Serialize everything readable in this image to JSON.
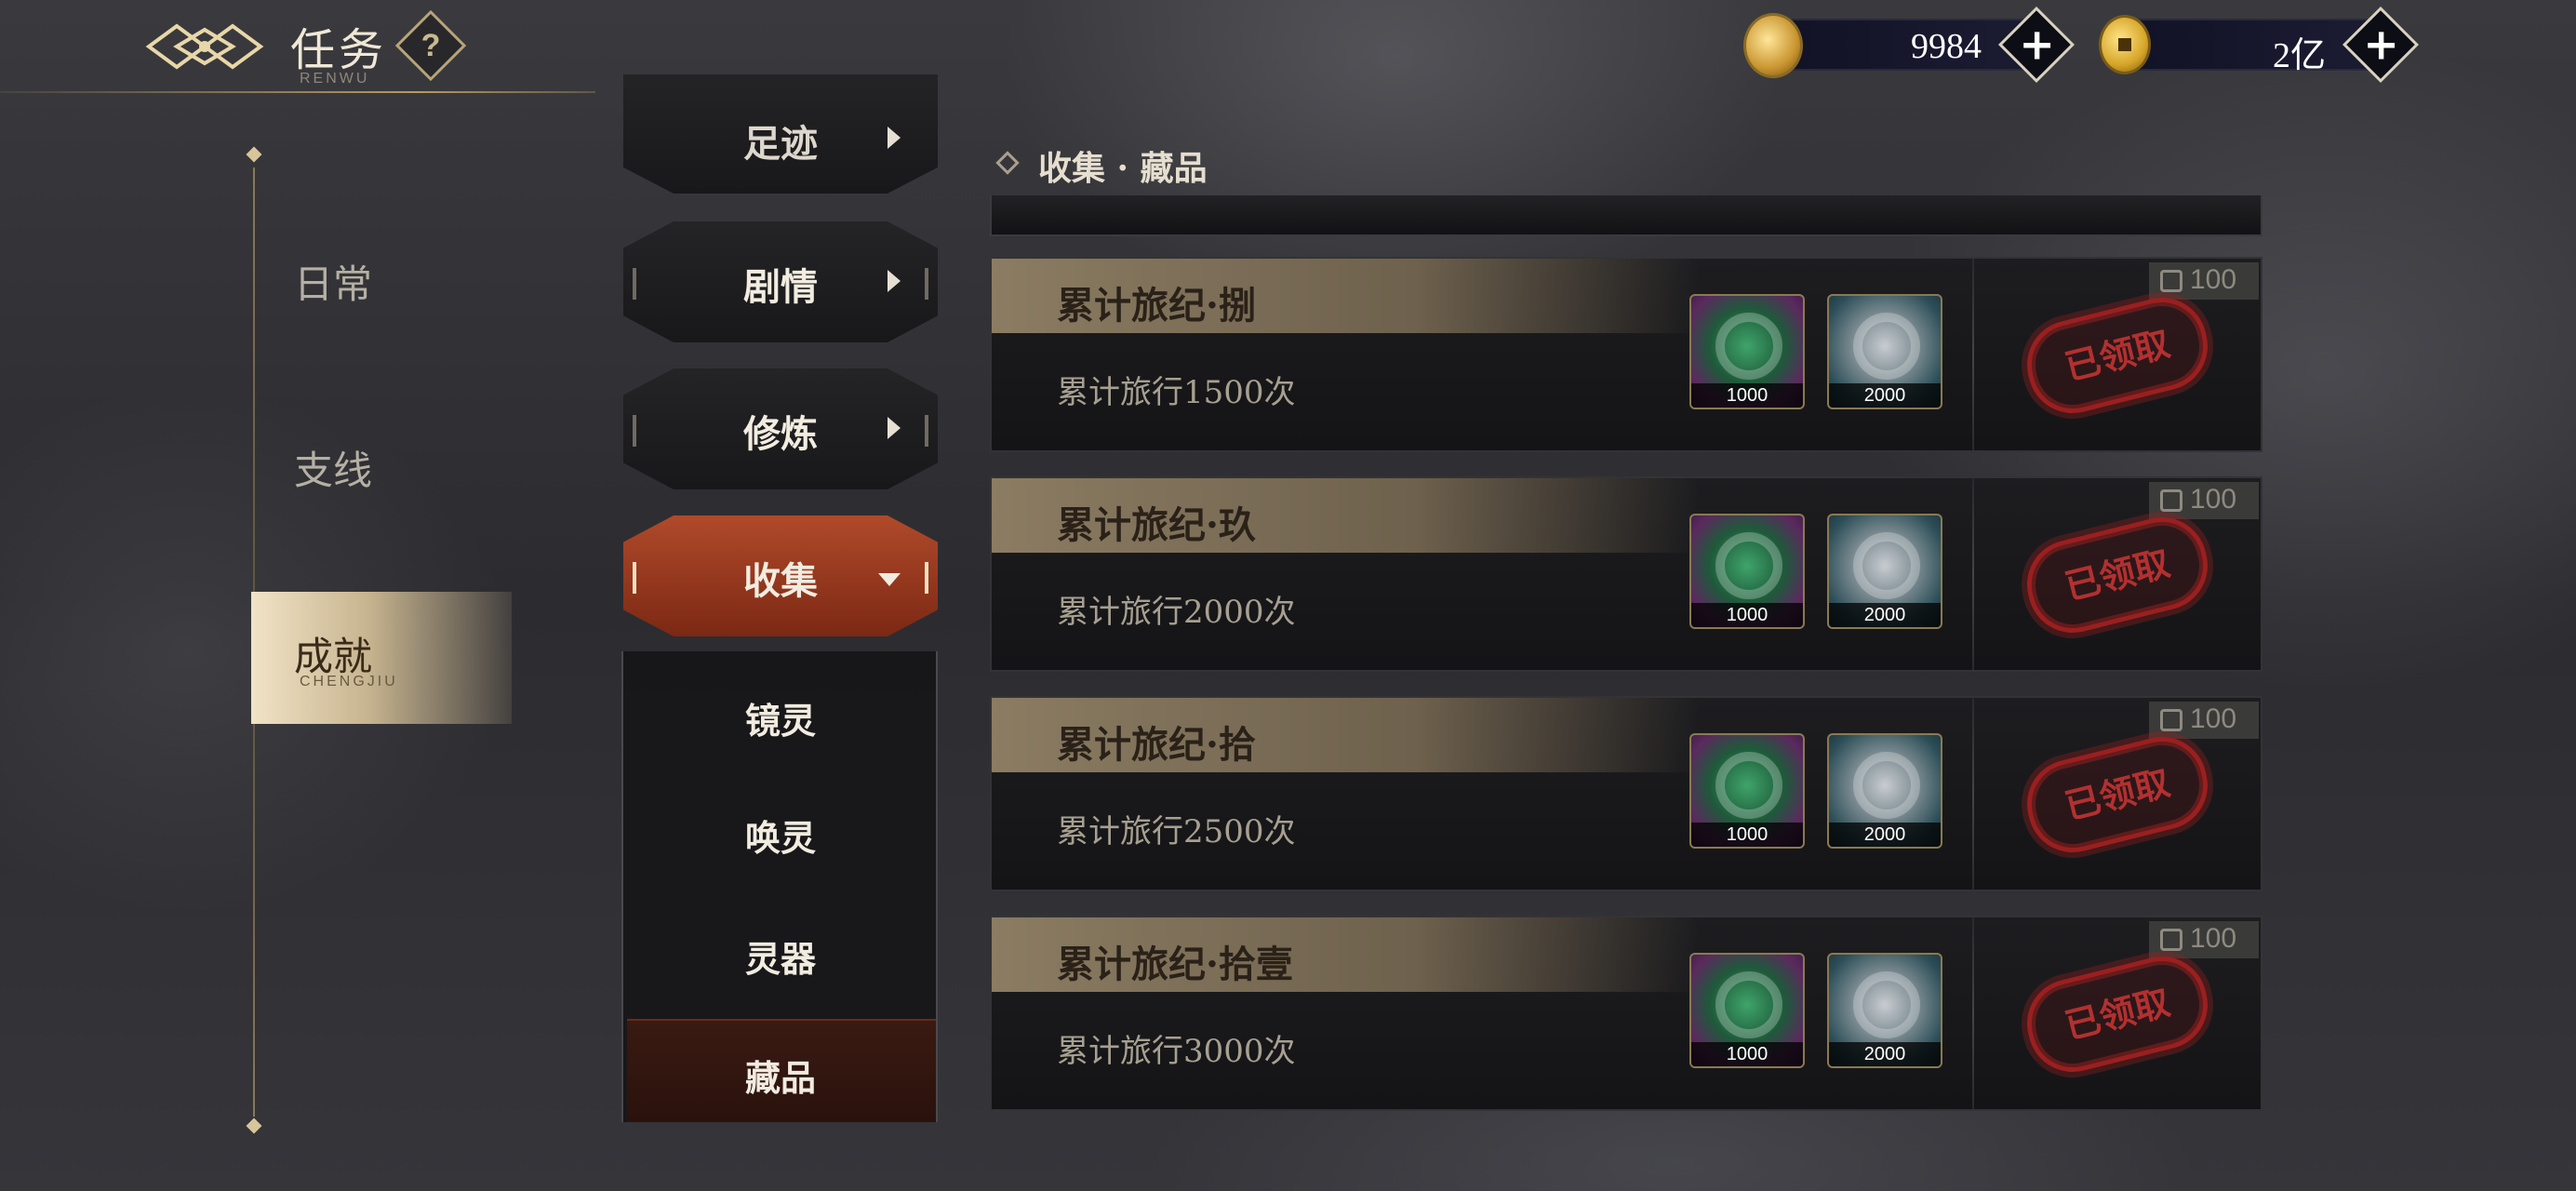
{
  "header": {
    "title": "任务",
    "subtitle": "RENWU",
    "help": "?"
  },
  "currency": [
    {
      "icon": "jade-dragon-icon",
      "value": "9984",
      "plus": "+"
    },
    {
      "icon": "gold-coin-icon",
      "value": "2亿",
      "plus": "+"
    }
  ],
  "left_nav": {
    "items": [
      {
        "label": "日常"
      },
      {
        "label": "支线"
      }
    ],
    "active": {
      "label": "成就",
      "sub": "CHENGJIU"
    }
  },
  "menu": {
    "items": [
      {
        "label": "足迹"
      },
      {
        "label": "剧情"
      },
      {
        "label": "修炼"
      },
      {
        "label": "收集"
      }
    ],
    "subitems": [
      {
        "label": "镜灵"
      },
      {
        "label": "唤灵"
      },
      {
        "label": "灵器"
      },
      {
        "label": "藏品"
      }
    ]
  },
  "section": {
    "title": "收集 · 藏品"
  },
  "tasks": [
    {
      "name": "累计旅纪·捌",
      "desc": "累计旅行1500次",
      "rewards": [
        "1000",
        "2000"
      ],
      "points": "100",
      "status": "已领取"
    },
    {
      "name": "累计旅纪·玖",
      "desc": "累计旅行2000次",
      "rewards": [
        "1000",
        "2000"
      ],
      "points": "100",
      "status": "已领取"
    },
    {
      "name": "累计旅纪·拾",
      "desc": "累计旅行2500次",
      "rewards": [
        "1000",
        "2000"
      ],
      "points": "100",
      "status": "已领取"
    },
    {
      "name": "累计旅纪·拾壹",
      "desc": "累计旅行3000次",
      "rewards": [
        "1000",
        "2000"
      ],
      "points": "100",
      "status": "已领取"
    }
  ]
}
